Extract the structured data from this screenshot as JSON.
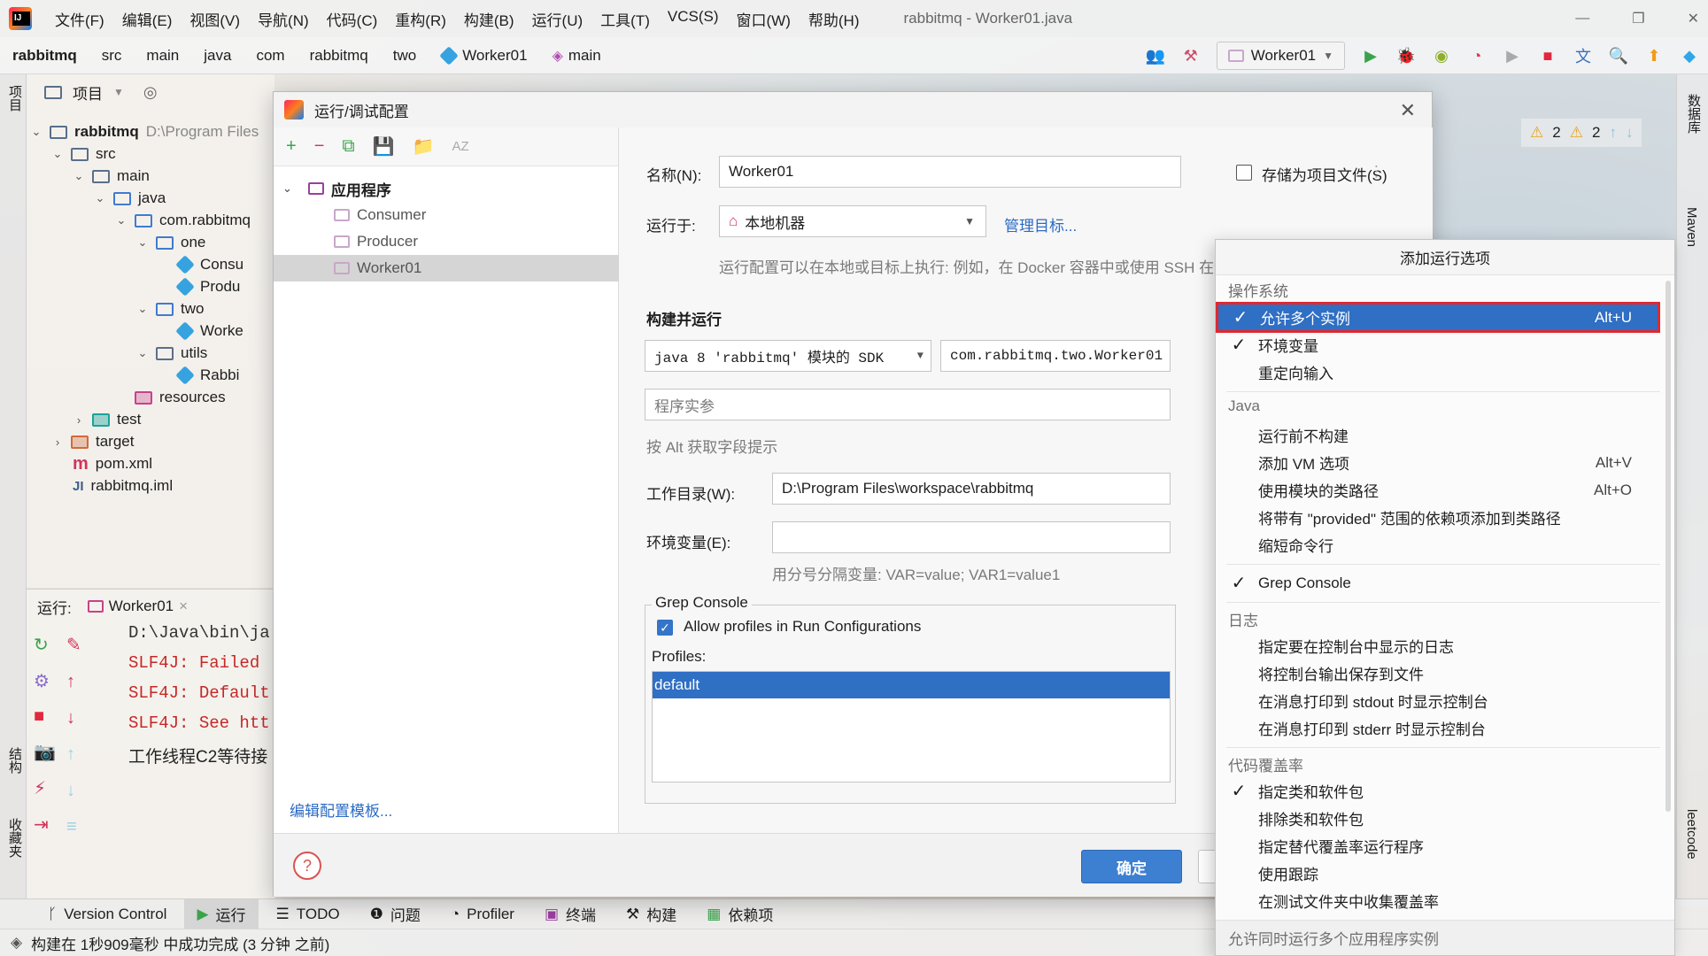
{
  "app": {
    "menu": [
      "文件(F)",
      "编辑(E)",
      "视图(V)",
      "导航(N)",
      "代码(C)",
      "重构(R)",
      "构建(B)",
      "运行(U)",
      "工具(T)",
      "VCS(S)",
      "窗口(W)",
      "帮助(H)"
    ],
    "window_title": "rabbitmq - Worker01.java"
  },
  "nav": {
    "crumbs": [
      "rabbitmq",
      "src",
      "main",
      "java",
      "com",
      "rabbitmq",
      "two",
      "Worker01",
      "main"
    ],
    "run_config": "Worker01"
  },
  "left_stripe": {
    "project": "项目",
    "structure": "结构",
    "favorites": "收藏夹"
  },
  "right_stripe": {
    "database": "数据库",
    "maven": "Maven",
    "leetcode": "leetcode"
  },
  "project_panel": {
    "title": "项目",
    "tree": [
      {
        "label": "rabbitmq",
        "extra": "D:\\Program Files"
      },
      {
        "label": "src"
      },
      {
        "label": "main"
      },
      {
        "label": "java"
      },
      {
        "label": "com.rabbitmq"
      },
      {
        "label": "one"
      },
      {
        "label": "Consu"
      },
      {
        "label": "Produ"
      },
      {
        "label": "two"
      },
      {
        "label": "Worke"
      },
      {
        "label": "utils"
      },
      {
        "label": "Rabbi"
      },
      {
        "label": "resources"
      },
      {
        "label": "test"
      },
      {
        "label": "target"
      },
      {
        "label": "pom.xml"
      },
      {
        "label": "rabbitmq.iml"
      }
    ],
    "inspections": {
      "warn1": "2",
      "warn2": "2"
    }
  },
  "run_panel": {
    "label": "运行:",
    "tab": "Worker01",
    "lines": [
      "D:\\Java\\bin\\ja",
      "SLF4J: Failed",
      "SLF4J: Default",
      "SLF4J: See htt",
      "工作线程C2等待接"
    ]
  },
  "bottom_tools": [
    "Version Control",
    "运行",
    "TODO",
    "问题",
    "Profiler",
    "终端",
    "构建",
    "依赖项"
  ],
  "status": "构建在 1秒909毫秒 中成功完成 (3 分钟 之前)",
  "dialog": {
    "title": "运行/调试配置",
    "tree_root": "应用程序",
    "configs": [
      "Consumer",
      "Producer",
      "Worker01"
    ],
    "edit_templates": "编辑配置模板...",
    "name_label": "名称(N):",
    "name_value": "Worker01",
    "store_label": "存储为项目文件(S)",
    "run_on_label": "运行于:",
    "run_on_value": "本地机器",
    "manage_targets": "管理目标...",
    "run_on_hint": "运行配置可以在本地或目标上执行: 例如，在 Docker 容器中或使用 SSH 在远",
    "build_run": "构建并运行",
    "sdk_value": "java 8 'rabbitmq' 模块的 SDK",
    "main_class": "com.rabbitmq.two.Worker01",
    "program_args_placeholder": "程序实参",
    "alt_hint": "按 Alt 获取字段提示",
    "workdir_label": "工作目录(W):",
    "workdir_value": "D:\\Program Files\\workspace\\rabbitmq",
    "env_label": "环境变量(E):",
    "env_value": "",
    "env_hint": "用分号分隔变量: VAR=value; VAR1=value1",
    "grep_title": "Grep Console",
    "grep_allow": "Allow profiles in Run Configurations",
    "profiles_label": "Profiles:",
    "profiles": [
      "default"
    ],
    "ok": "确定",
    "help": "?"
  },
  "popup": {
    "title": "添加运行选项",
    "sections": [
      {
        "name": "操作系统",
        "items": [
          {
            "label": "允许多个实例",
            "shortcut": "Alt+U",
            "checked": true,
            "highlighted": true
          },
          {
            "label": "环境变量",
            "shortcut": "",
            "checked": true
          },
          {
            "label": "重定向输入",
            "shortcut": "",
            "checked": false
          }
        ]
      },
      {
        "name": "Java",
        "items": [
          {
            "label": "运行前不构建",
            "shortcut": "",
            "checked": false
          },
          {
            "label": "添加 VM 选项",
            "shortcut": "Alt+V",
            "checked": false
          },
          {
            "label": "使用模块的类路径",
            "shortcut": "Alt+O",
            "checked": false
          },
          {
            "label": "将带有 \"provided\" 范围的依赖项添加到类路径",
            "shortcut": "",
            "checked": false
          },
          {
            "label": "缩短命令行",
            "shortcut": "",
            "checked": false
          }
        ]
      },
      {
        "name": "",
        "items": [
          {
            "label": "Grep Console",
            "shortcut": "",
            "checked": true
          }
        ]
      },
      {
        "name": "日志",
        "items": [
          {
            "label": "指定要在控制台中显示的日志",
            "shortcut": "",
            "checked": false
          },
          {
            "label": "将控制台输出保存到文件",
            "shortcut": "",
            "checked": false
          },
          {
            "label": "在消息打印到 stdout 时显示控制台",
            "shortcut": "",
            "checked": false
          },
          {
            "label": "在消息打印到 stderr 时显示控制台",
            "shortcut": "",
            "checked": false
          }
        ]
      },
      {
        "name": "代码覆盖率",
        "items": [
          {
            "label": "指定类和软件包",
            "shortcut": "",
            "checked": true
          },
          {
            "label": "排除类和软件包",
            "shortcut": "",
            "checked": false
          },
          {
            "label": "指定替代覆盖率运行程序",
            "shortcut": "",
            "checked": false
          },
          {
            "label": "使用跟踪",
            "shortcut": "",
            "checked": false
          },
          {
            "label": "在测试文件夹中收集覆盖率",
            "shortcut": "",
            "checked": false
          }
        ]
      }
    ],
    "footer": "允许同时运行多个应用程序实例"
  }
}
